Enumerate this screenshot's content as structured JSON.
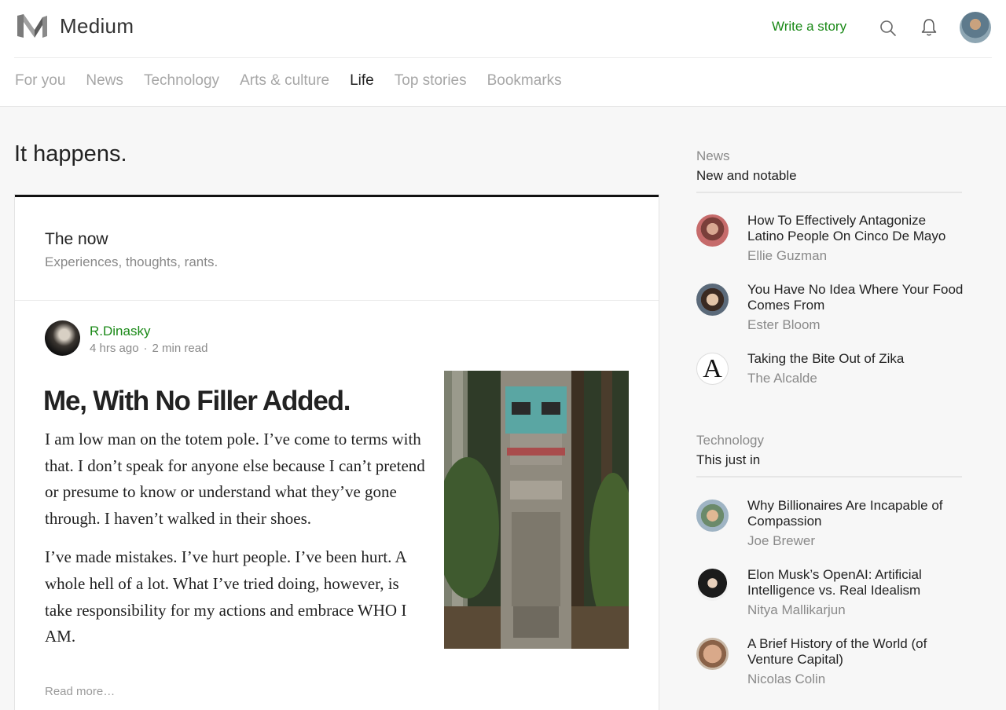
{
  "header": {
    "brand": "Medium",
    "write_label": "Write a story"
  },
  "nav": {
    "tabs": [
      {
        "label": "For you"
      },
      {
        "label": "News"
      },
      {
        "label": "Technology"
      },
      {
        "label": "Arts & culture"
      },
      {
        "label": "Life",
        "active": true
      },
      {
        "label": "Top stories"
      },
      {
        "label": "Bookmarks"
      }
    ]
  },
  "page": {
    "title": "It happens."
  },
  "section": {
    "title": "The now",
    "subtitle": "Experiences, thoughts, rants."
  },
  "post": {
    "author": "R.Dinasky",
    "time": "4 hrs ago",
    "separator": "·",
    "read_time": "2 min read",
    "title": "Me, With No Filler Added.",
    "paragraphs": [
      "I am low man on the totem pole. I’ve come to terms with that. I don’t speak for anyone else because I can’t pretend or presume to know or understand what they’ve gone through. I haven’t walked in their shoes.",
      "I’ve made mistakes. I’ve hurt people. I’ve been hurt. A whole hell of a lot. What I’ve tried doing, however, is take responsibility for my actions and embrace WHO I AM."
    ],
    "read_more": "Read more…"
  },
  "sidebar": {
    "news": {
      "kicker": "News",
      "title": "New and notable",
      "items": [
        {
          "title": "How To Effectively Antagonize Latino People On Cinco De Mayo",
          "author": "Ellie Guzman"
        },
        {
          "title": "You Have No Idea Where Your Food Comes From",
          "author": "Ester Bloom"
        },
        {
          "title": "Taking the Bite Out of Zika",
          "author": "The Alcalde",
          "avatar_letter": "A"
        }
      ]
    },
    "technology": {
      "kicker": "Technology",
      "title": "This just in",
      "items": [
        {
          "title": "Why Billionaires Are Incapable of Compassion",
          "author": "Joe Brewer"
        },
        {
          "title": "Elon Musk’s OpenAI: Artificial Intelligence vs. Real Idealism",
          "author": "Nitya Mallikarjun"
        },
        {
          "title": "A Brief History of the World (of Venture Capital)",
          "author": "Nicolas Colin"
        }
      ]
    }
  },
  "colors": {
    "accent_green": "#1a8917",
    "muted_gray": "#8a8a8a"
  }
}
